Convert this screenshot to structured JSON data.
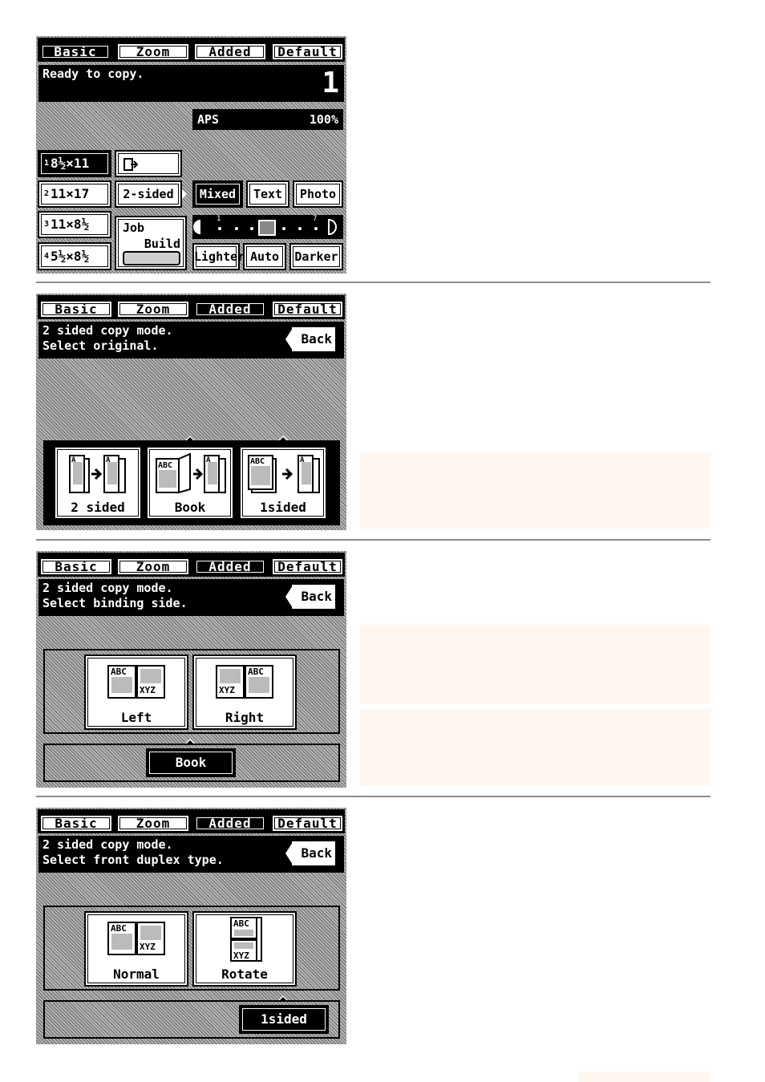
{
  "tabs": [
    "Basic",
    "Zoom",
    "Added",
    "Default"
  ],
  "screen1": {
    "status": "Ready to copy.",
    "copy_count": "1",
    "aps_label": "APS",
    "zoom_value": "100%",
    "paper_sizes": [
      {
        "num": "1",
        "label": "8½×11"
      },
      {
        "num": "2",
        "label": "11×17"
      },
      {
        "num": "3",
        "label": "11×8½"
      },
      {
        "num": "4",
        "label": "5½×8½"
      }
    ],
    "duplex_label": "2-sided",
    "job_build": [
      "Job",
      "Build"
    ],
    "image_modes": [
      "Mixed",
      "Text",
      "Photo"
    ],
    "density_buttons": [
      "Lighter",
      "Auto",
      "Darker"
    ],
    "density_ticks": [
      "1",
      "7"
    ]
  },
  "screen2": {
    "line1": "2 sided copy mode.",
    "line2": "Select original.",
    "back": "Back",
    "options": [
      "2 sided",
      "Book",
      "1sided"
    ]
  },
  "screen3": {
    "line1": "2 sided copy mode.",
    "line2": "Select binding side.",
    "back": "Back",
    "options": [
      "Left",
      "Right"
    ],
    "selected": "Book"
  },
  "screen4": {
    "line1": "2 sided copy mode.",
    "line2": "Select front duplex type.",
    "back": "Back",
    "options": [
      "Normal",
      "Rotate"
    ],
    "selected": "1sided"
  },
  "icon_text": {
    "abc": "ABC",
    "xyz": "XYZ",
    "a": "A",
    "z": "Z"
  },
  "colors": {
    "screen_bg": "#000000",
    "button_bg": "#ffffff",
    "divider": "#8c8c8c",
    "note_bg": "#fdf7ef"
  }
}
